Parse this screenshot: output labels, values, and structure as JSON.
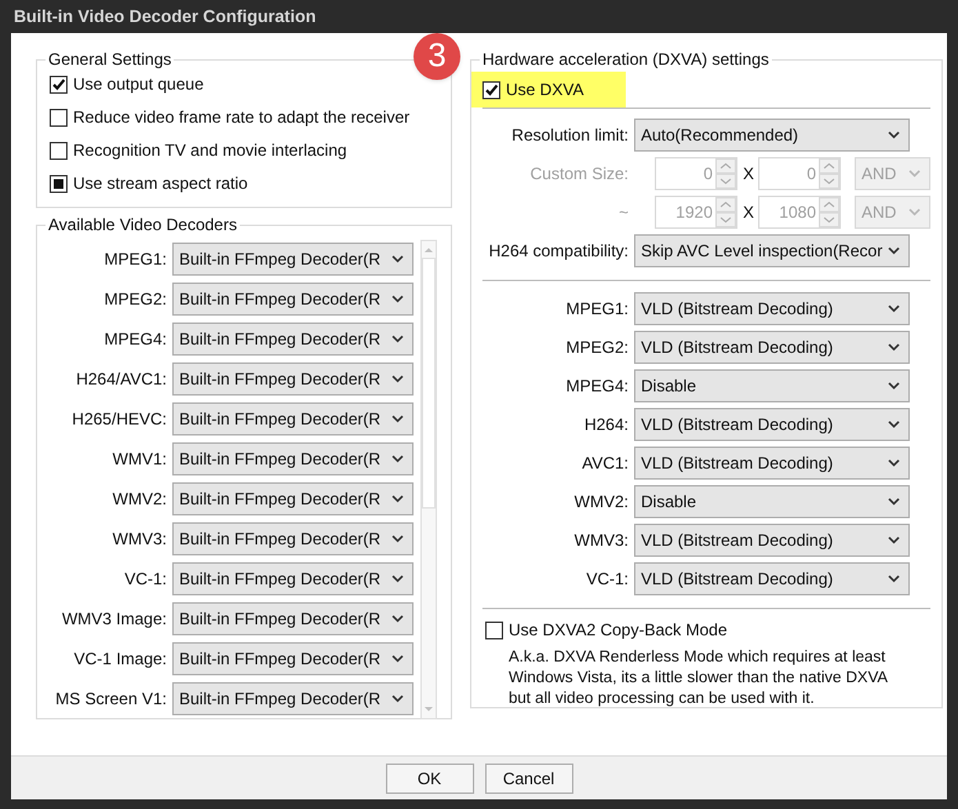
{
  "window": {
    "title": "Built-in Video Decoder Configuration"
  },
  "badge": "3",
  "general_settings": {
    "title": "General Settings",
    "options": [
      {
        "label": "Use output queue",
        "checked": true,
        "mixed": false
      },
      {
        "label": "Reduce video frame rate to adapt the receiver",
        "checked": false,
        "mixed": false
      },
      {
        "label": "Recognition TV and movie interlacing",
        "checked": false,
        "mixed": false
      },
      {
        "label": "Use stream aspect ratio",
        "checked": false,
        "mixed": true
      }
    ]
  },
  "decoders": {
    "title": "Available Video Decoders",
    "rows": [
      {
        "label": "MPEG1:",
        "value": "Built-in FFmpeg Decoder(R"
      },
      {
        "label": "MPEG2:",
        "value": "Built-in FFmpeg Decoder(R"
      },
      {
        "label": "MPEG4:",
        "value": "Built-in FFmpeg Decoder(R"
      },
      {
        "label": "H264/AVC1:",
        "value": "Built-in FFmpeg Decoder(R"
      },
      {
        "label": "H265/HEVC:",
        "value": "Built-in FFmpeg Decoder(R"
      },
      {
        "label": "WMV1:",
        "value": "Built-in FFmpeg Decoder(R"
      },
      {
        "label": "WMV2:",
        "value": "Built-in FFmpeg Decoder(R"
      },
      {
        "label": "WMV3:",
        "value": "Built-in FFmpeg Decoder(R"
      },
      {
        "label": "VC-1:",
        "value": "Built-in FFmpeg Decoder(R"
      },
      {
        "label": "WMV3 Image:",
        "value": "Built-in FFmpeg Decoder(R"
      },
      {
        "label": "VC-1 Image:",
        "value": "Built-in FFmpeg Decoder(R"
      },
      {
        "label": "MS Screen V1:",
        "value": "Built-in FFmpeg Decoder(R"
      }
    ]
  },
  "dxva": {
    "title": "Hardware acceleration (DXVA) settings",
    "use_dxva": {
      "label": "Use DXVA",
      "checked": true,
      "highlighted": true
    },
    "resolution_limit": {
      "label": "Resolution limit:",
      "value": "Auto(Recommended)"
    },
    "size_rows": [
      {
        "label": "Custom Size:",
        "disabled": true,
        "first": "0",
        "separator": "X",
        "second": "0",
        "operator": "AND"
      },
      {
        "label": "~",
        "disabled": true,
        "first": "1920",
        "separator": "X",
        "second": "1080",
        "operator": "AND"
      }
    ],
    "h264_compatibility": {
      "label": "H264 compatibility:",
      "value": "Skip AVC Level inspection(Recor"
    },
    "codecs": [
      {
        "label": "MPEG1:",
        "value": "VLD (Bitstream Decoding)"
      },
      {
        "label": "MPEG2:",
        "value": "VLD (Bitstream Decoding)"
      },
      {
        "label": "MPEG4:",
        "value": "Disable"
      },
      {
        "label": "H264:",
        "value": "VLD (Bitstream Decoding)"
      },
      {
        "label": "AVC1:",
        "value": "VLD (Bitstream Decoding)"
      },
      {
        "label": "WMV2:",
        "value": "Disable"
      },
      {
        "label": "WMV3:",
        "value": "VLD (Bitstream Decoding)"
      },
      {
        "label": "VC-1:",
        "value": "VLD (Bitstream Decoding)"
      }
    ],
    "copy_back": {
      "label": "Use DXVA2 Copy-Back Mode",
      "checked": false,
      "description": "A.k.a. DXVA Renderless Mode which requires at least Windows Vista, its a little slower than the native DXVA but all video processing can be used with it."
    }
  },
  "buttons": [
    {
      "label": "OK"
    },
    {
      "label": "Cancel"
    }
  ]
}
